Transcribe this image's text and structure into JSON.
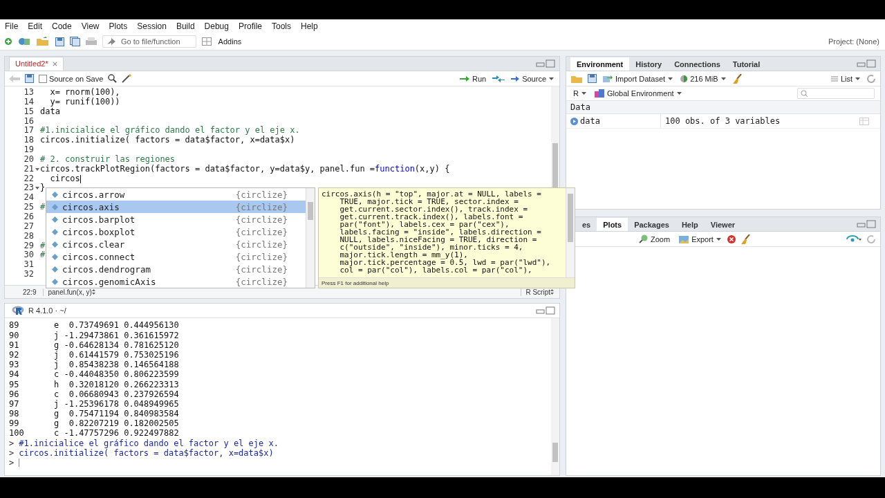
{
  "menu": [
    "File",
    "Edit",
    "Code",
    "View",
    "Plots",
    "Session",
    "Build",
    "Debug",
    "Profile",
    "Tools",
    "Help"
  ],
  "toolbar": {
    "goto_placeholder": "Go to file/function",
    "addins": "Addins",
    "project": "Project: (None)"
  },
  "editor": {
    "tabs": [
      {
        "label": "Untitled2*",
        "selected": true
      }
    ],
    "source_on_save": {
      "label": "Source on Save",
      "checked": false
    },
    "run": "Run",
    "source": "Source",
    "lines": [
      {
        "number": "13",
        "fold": false,
        "cursor": false,
        "segments": [
          {
            "text": "  x= rnorm(100),",
            "kind": "code"
          }
        ]
      },
      {
        "number": "14",
        "fold": false,
        "cursor": false,
        "segments": [
          {
            "text": "  y= runif(100))",
            "kind": "code"
          }
        ]
      },
      {
        "number": "15",
        "fold": false,
        "cursor": false,
        "segments": [
          {
            "text": "data",
            "kind": "code"
          }
        ]
      },
      {
        "number": "16",
        "fold": false,
        "cursor": false
      },
      {
        "number": "17",
        "fold": false,
        "cursor": false,
        "segments": [
          {
            "text": "#1.inicialice el gráfico dando el factor y el eje x.",
            "kind": "comment"
          }
        ]
      },
      {
        "number": "18",
        "fold": false,
        "cursor": false,
        "segments": [
          {
            "text": "circos.initialize( factors = data$factor, x=data$x)",
            "kind": "code"
          }
        ]
      },
      {
        "number": "19",
        "fold": false,
        "cursor": false
      },
      {
        "number": "20",
        "fold": false,
        "cursor": false,
        "segments": [
          {
            "text": "# 2. construir las regiones",
            "kind": "comment"
          }
        ]
      },
      {
        "number": "21",
        "fold": true,
        "cursor": false,
        "segments": [
          {
            "text": "circos.trackPlotRegion(factors = data$factor, y=data$y, panel.fun =",
            "kind": "code"
          },
          {
            "text": "function",
            "kind": "keyword"
          },
          {
            "text": "(x,y) {",
            "kind": "code"
          }
        ]
      },
      {
        "number": "22",
        "fold": false,
        "cursor": true,
        "segments": [
          {
            "text": "  circos",
            "kind": "code"
          }
        ]
      },
      {
        "number": "23",
        "fold": true,
        "cursor": false,
        "segments": [
          {
            "text": "}",
            "kind": "code"
          }
        ]
      },
      {
        "number": "24",
        "fold": false,
        "cursor": false
      },
      {
        "number": "25",
        "fold": false,
        "cursor": false,
        "segments": [
          {
            "text": "#",
            "kind": "comment"
          }
        ]
      },
      {
        "number": "26",
        "fold": false,
        "cursor": false
      },
      {
        "number": "27",
        "fold": false,
        "cursor": false
      },
      {
        "number": "28",
        "fold": false,
        "cursor": false
      },
      {
        "number": "29",
        "fold": false,
        "cursor": false,
        "segments": [
          {
            "text": "#",
            "kind": "comment"
          }
        ]
      },
      {
        "number": "30",
        "fold": false,
        "cursor": false,
        "segments": [
          {
            "text": "#",
            "kind": "comment"
          }
        ]
      },
      {
        "number": "31",
        "fold": false,
        "cursor": false
      },
      {
        "number": "32",
        "fold": false,
        "cursor": false
      }
    ],
    "cursor_position": "22:9",
    "scope": "panel.fun(x, y)",
    "file_type": "R Script"
  },
  "completion": {
    "items": [
      {
        "name": "circos.arrow",
        "package": "{circlize}",
        "selected": false
      },
      {
        "name": "circos.axis",
        "package": "{circlize}",
        "selected": true
      },
      {
        "name": "circos.barplot",
        "package": "{circlize}",
        "selected": false
      },
      {
        "name": "circos.boxplot",
        "package": "{circlize}",
        "selected": false
      },
      {
        "name": "circos.clear",
        "package": "{circlize}",
        "selected": false
      },
      {
        "name": "circos.connect",
        "package": "{circlize}",
        "selected": false
      },
      {
        "name": "circos.dendrogram",
        "package": "{circlize}",
        "selected": false
      },
      {
        "name": "circos.genomicAxis",
        "package": "{circlize}",
        "selected": false
      }
    ],
    "help_lines": [
      "circos.axis(h = \"top\", major.at = NULL, labels =",
      "    TRUE, major.tick = TRUE, sector.index =",
      "    get.current.sector.index(), track.index =",
      "    get.current.track.index(), labels.font =",
      "    par(\"font\"), labels.cex = par(\"cex\"),",
      "    labels.facing = \"inside\", labels.direction =",
      "    NULL, labels.niceFacing = TRUE, direction =",
      "    c(\"outside\", \"inside\"), minor.ticks = 4,",
      "    major.tick.length = mm_y(1),",
      "    major.tick.percentage = 0.5, lwd = par(\"lwd\"),",
      "    col = par(\"col\"), labels.col = par(\"col\"),"
    ],
    "help_hint": "Press F1 for additional help"
  },
  "console": {
    "title": "R 4.1.0 · ~/",
    "lines": [
      {
        "kind": "output",
        "text": "89       e  0.73749691 0.444956130"
      },
      {
        "kind": "output",
        "text": "90       j -1.29473861 0.361615972"
      },
      {
        "kind": "output",
        "text": "91       g -0.64628134 0.781625120"
      },
      {
        "kind": "output",
        "text": "92       j  0.61441579 0.753025196"
      },
      {
        "kind": "output",
        "text": "93       j  0.85438238 0.146564188"
      },
      {
        "kind": "output",
        "text": "94       c -0.44048350 0.806223599"
      },
      {
        "kind": "output",
        "text": "95       h  0.32018120 0.266223313"
      },
      {
        "kind": "output",
        "text": "96       c  0.06680943 0.237926594"
      },
      {
        "kind": "output",
        "text": "97       j -1.25396178 0.048949965"
      },
      {
        "kind": "output",
        "text": "98       g  0.75471194 0.840983584"
      },
      {
        "kind": "output",
        "text": "99       g  0.82207219 0.182002505"
      },
      {
        "kind": "output",
        "text": "100      c -1.47757296 0.922497882"
      },
      {
        "kind": "command",
        "prompt": ">",
        "text": "#1.inicialice el gráfico dando el factor y el eje x."
      },
      {
        "kind": "command",
        "prompt": ">",
        "text": "circos.initialize( factors = data$factor, x=data$x)"
      },
      {
        "kind": "input",
        "prompt": ">"
      }
    ]
  },
  "environment": {
    "tabs": [
      {
        "label": "Environment",
        "selected": true
      },
      {
        "label": "History",
        "selected": false
      },
      {
        "label": "Connections",
        "selected": false
      },
      {
        "label": "Tutorial",
        "selected": false
      }
    ],
    "import": "Import Dataset",
    "memory": "216 MiB",
    "view": "List",
    "language": "R",
    "scope": "Global Environment",
    "section": "Data",
    "rows": [
      {
        "name": "data",
        "value": "100 obs. of 3 variables"
      }
    ]
  },
  "plots": {
    "tabs": [
      {
        "label": "es",
        "selected": false
      },
      {
        "label": "Plots",
        "selected": true
      },
      {
        "label": "Packages",
        "selected": false
      },
      {
        "label": "Help",
        "selected": false
      },
      {
        "label": "Viewer",
        "selected": false
      }
    ],
    "zoom": "Zoom",
    "export": "Export"
  }
}
